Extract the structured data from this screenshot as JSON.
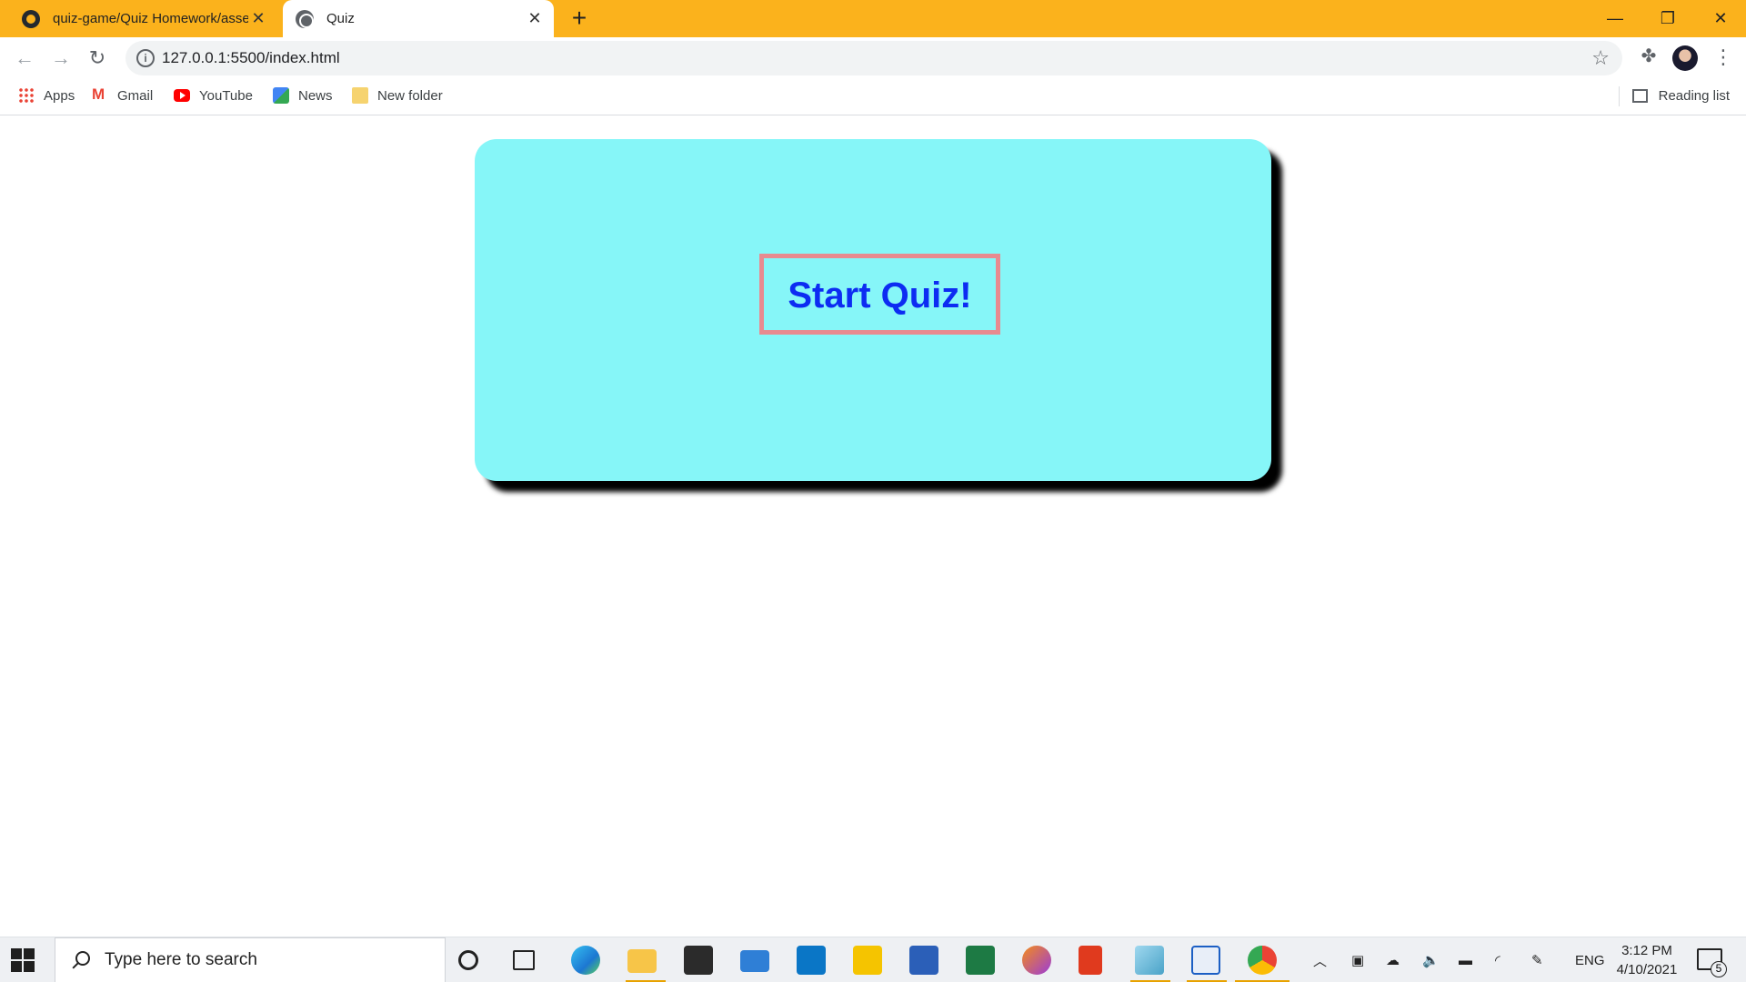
{
  "browser": {
    "tabs": [
      {
        "label": "quiz-game/Quiz Homework/asse",
        "icon": "github-icon",
        "active": false
      },
      {
        "label": "Quiz",
        "icon": "globe-icon",
        "active": true
      }
    ],
    "new_tab_label": "+",
    "url": "127.0.0.1:5500/index.html",
    "bookmarks": [
      {
        "label": "Apps",
        "icon": "apps-grid-icon"
      },
      {
        "label": "Gmail",
        "icon": "gmail-icon"
      },
      {
        "label": "YouTube",
        "icon": "youtube-icon"
      },
      {
        "label": "News",
        "icon": "news-icon"
      },
      {
        "label": "New folder",
        "icon": "folder-icon"
      }
    ],
    "reading_list": "Reading list",
    "colors": {
      "titlebar": "#fbb21c"
    }
  },
  "page": {
    "start_button": "Start Quiz!",
    "colors": {
      "card": "#86f6f8",
      "button_text": "#0d2cf2",
      "button_border": "#e88a90"
    }
  },
  "taskbar": {
    "search_placeholder": "Type here to search",
    "apps": [
      "cortana-icon",
      "task-view-icon",
      "edge-icon",
      "file-explorer-icon",
      "store-icon",
      "mail-icon",
      "dell-icon",
      "sticky-app-icon",
      "word-icon",
      "excel-icon",
      "brave-icon",
      "office-icon",
      "notes-icon",
      "window-app-icon",
      "chrome-icon"
    ],
    "language": "ENG",
    "time": "3:12 PM",
    "date": "4/10/2021",
    "notification_count": "5"
  }
}
